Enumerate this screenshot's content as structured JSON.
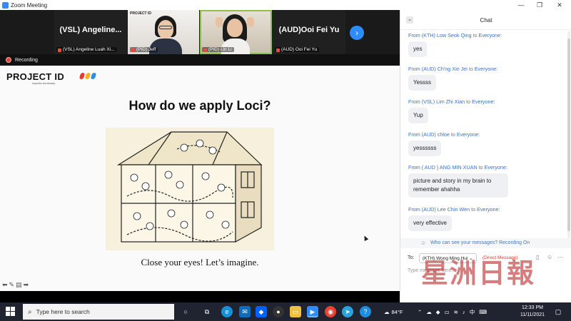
{
  "window": {
    "title": "Zoom Meeting"
  },
  "gallery": {
    "tiles": [
      {
        "big_name": "(VSL)  Angeline...",
        "label": "(VSL) Angeline Luah Xi..."
      },
      {
        "label": "(PID) Jeff",
        "slide_logo": "PROJECT ID"
      },
      {
        "label": "(PID) Lin Li"
      },
      {
        "big_name": "(AUD)Ooi Fei Yu",
        "label": "(AUD) Ooi Fei Yu"
      }
    ]
  },
  "recording": {
    "label": "Recording"
  },
  "slide": {
    "logo": "PROJECT ID",
    "logo_sub": "mysuitu bootcamp",
    "logo_colors": [
      "#e63b2e",
      "#f5b323",
      "#2f8ce0"
    ],
    "title": "How do we apply Loci?",
    "caption": "Close your eyes! Let’s imagine."
  },
  "chat": {
    "title": "Chat",
    "to_word": "to",
    "messages": [
      {
        "from": "From (KTH) Low Seok Qing",
        "to": "Everyone:",
        "text": "yes"
      },
      {
        "from": "From (AUD) Ch'ng Xin Jei",
        "to": "Everyone:",
        "text": "Yessss"
      },
      {
        "from": "From (VSL) Lim Zhi Xian",
        "to": "Everyone:",
        "text": "Yup"
      },
      {
        "from": "From (AUD) chloe",
        "to": "Everyone:",
        "text": "yessssss"
      },
      {
        "from": "From ( AUD ) ANG MIN XUAN",
        "to": "Everyone:",
        "text": "picture and story in my brain to remember ahahha"
      },
      {
        "from": "From (AUD) Lee Chin Wen",
        "to": "Everyone:",
        "text": "very effective"
      }
    ],
    "who_can_see": "Who can see your messages? Recording On",
    "to_label": "To:",
    "to_value": "(KTH) Wong Ming Hui",
    "direct_message": "(Direct Message)",
    "input_placeholder": "Type message here..."
  },
  "watermark": "星洲日報",
  "taskbar": {
    "search_placeholder": "Type here to search",
    "weather": "84°F",
    "ime": "中",
    "time": "12:33 PM",
    "date": "11/11/2021"
  }
}
